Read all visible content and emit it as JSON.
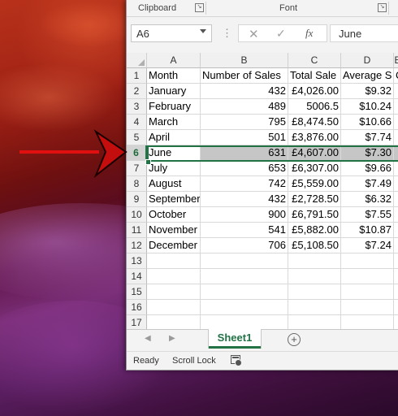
{
  "ribbon": {
    "clipboard_label": "Clipboard",
    "font_label": "Font",
    "launcher_glyph": "↘"
  },
  "formula_bar": {
    "name_box": "A6",
    "dots": "⋮",
    "cancel_glyph": "✕",
    "enter_glyph": "✓",
    "fx_label": "fx",
    "value": "June"
  },
  "columns": [
    {
      "letter": "A",
      "header": "Month"
    },
    {
      "letter": "B",
      "header": "Number of Sales"
    },
    {
      "letter": "C",
      "header": "Total Sale"
    },
    {
      "letter": "D",
      "header": "Average S"
    },
    {
      "letter": "E",
      "header": "C"
    }
  ],
  "header_row_number": "1",
  "rows": [
    {
      "num": "2",
      "month": "January",
      "sales": "432",
      "total": "£4,026.00",
      "avg": "$9.32"
    },
    {
      "num": "3",
      "month": "February",
      "sales": "489",
      "total": "5006.5",
      "avg": "$10.24"
    },
    {
      "num": "4",
      "month": "March",
      "sales": "795",
      "total": "£8,474.50",
      "avg": "$10.66"
    },
    {
      "num": "5",
      "month": "April",
      "sales": "501",
      "total": "£3,876.00",
      "avg": "$7.74"
    },
    {
      "num": "6",
      "month": "June",
      "sales": "631",
      "total": "£4,607.00",
      "avg": "$7.30"
    },
    {
      "num": "7",
      "month": "July",
      "sales": "653",
      "total": "£6,307.00",
      "avg": "$9.66"
    },
    {
      "num": "8",
      "month": "August",
      "sales": "742",
      "total": "£5,559.00",
      "avg": "$7.49"
    },
    {
      "num": "9",
      "month": "September",
      "sales": "432",
      "total": "£2,728.50",
      "avg": "$6.32"
    },
    {
      "num": "10",
      "month": "October",
      "sales": "900",
      "total": "£6,791.50",
      "avg": "$7.55"
    },
    {
      "num": "11",
      "month": "November",
      "sales": "541",
      "total": "£5,882.00",
      "avg": "$10.87"
    },
    {
      "num": "12",
      "month": "December",
      "sales": "706",
      "total": "£5,108.50",
      "avg": "$7.24"
    }
  ],
  "empty_rows": [
    "13",
    "14",
    "15",
    "16",
    "17"
  ],
  "selected_row": "6",
  "sheet_tabs": {
    "nav_prev": "◀",
    "nav_next": "▶",
    "active": "Sheet1",
    "add_glyph": "+"
  },
  "status_bar": {
    "ready": "Ready",
    "scroll_lock": "Scroll Lock"
  },
  "colors": {
    "excel_green": "#217346",
    "arrow_red": "#e01010"
  }
}
